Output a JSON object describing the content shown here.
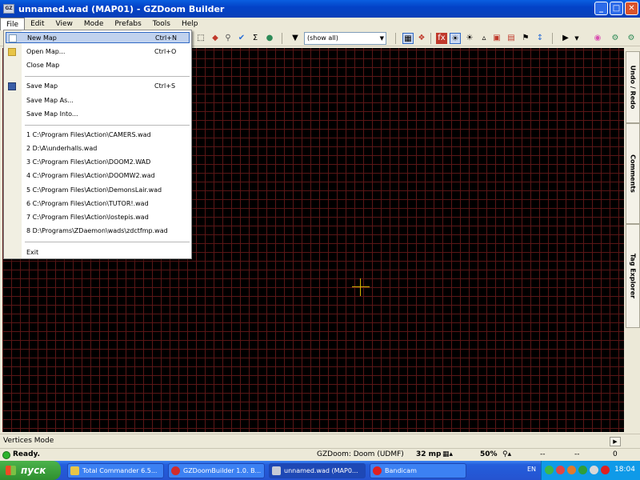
{
  "window": {
    "title": "unnamed.wad (MAP01) - GZDoom Builder",
    "app_icon_label": "GZ"
  },
  "menubar": {
    "items": [
      "File",
      "Edit",
      "View",
      "Mode",
      "Prefabs",
      "Tools",
      "Help"
    ]
  },
  "toolbar": {
    "filter_value": "(show all)"
  },
  "file_menu": {
    "new_map": {
      "label": "New Map",
      "shortcut": "Ctrl+N"
    },
    "open_map": {
      "label": "Open Map...",
      "shortcut": "Ctrl+O"
    },
    "close_map": {
      "label": "Close Map"
    },
    "save_map": {
      "label": "Save Map",
      "shortcut": "Ctrl+S"
    },
    "save_map_as": {
      "label": "Save Map As..."
    },
    "save_map_into": {
      "label": "Save Map Into..."
    },
    "recent": [
      "1  C:\\Program Files\\Action\\CAMERS.wad",
      "2  D:\\A\\underhalls.wad",
      "3  C:\\Program Files\\Action\\DOOM2.WAD",
      "4  C:\\Program Files\\Action\\DOOMW2.wad",
      "5  C:\\Program Files\\Action\\DemonsLair.wad",
      "6  C:\\Program Files\\Action\\TUTOR!.wad",
      "7  C:\\Program Files\\Action\\lostepis.wad",
      "8  D:\\Programs\\ZDaemon\\wads\\zdctfmp.wad"
    ],
    "exit": {
      "label": "Exit"
    }
  },
  "docker": {
    "tabs": [
      "Undo / Redo",
      "Comments",
      "Tag Explorer"
    ]
  },
  "modebar": {
    "mode": "Vertices Mode"
  },
  "status": {
    "ready": "Ready.",
    "engine": "GZDoom: Doom (UDMF)",
    "grid": "32 mp",
    "zoom": "50%",
    "coord_x": "--",
    "coord_y": "--",
    "count": "0"
  },
  "taskbar": {
    "start_label": "пуск",
    "tasks": [
      "Total Commander 6.5...",
      "GZDoomBuilder 1.0. B...",
      "unnamed.wad (MAP0...",
      "Bandicam"
    ],
    "lang": "EN",
    "clock": "18:04"
  }
}
